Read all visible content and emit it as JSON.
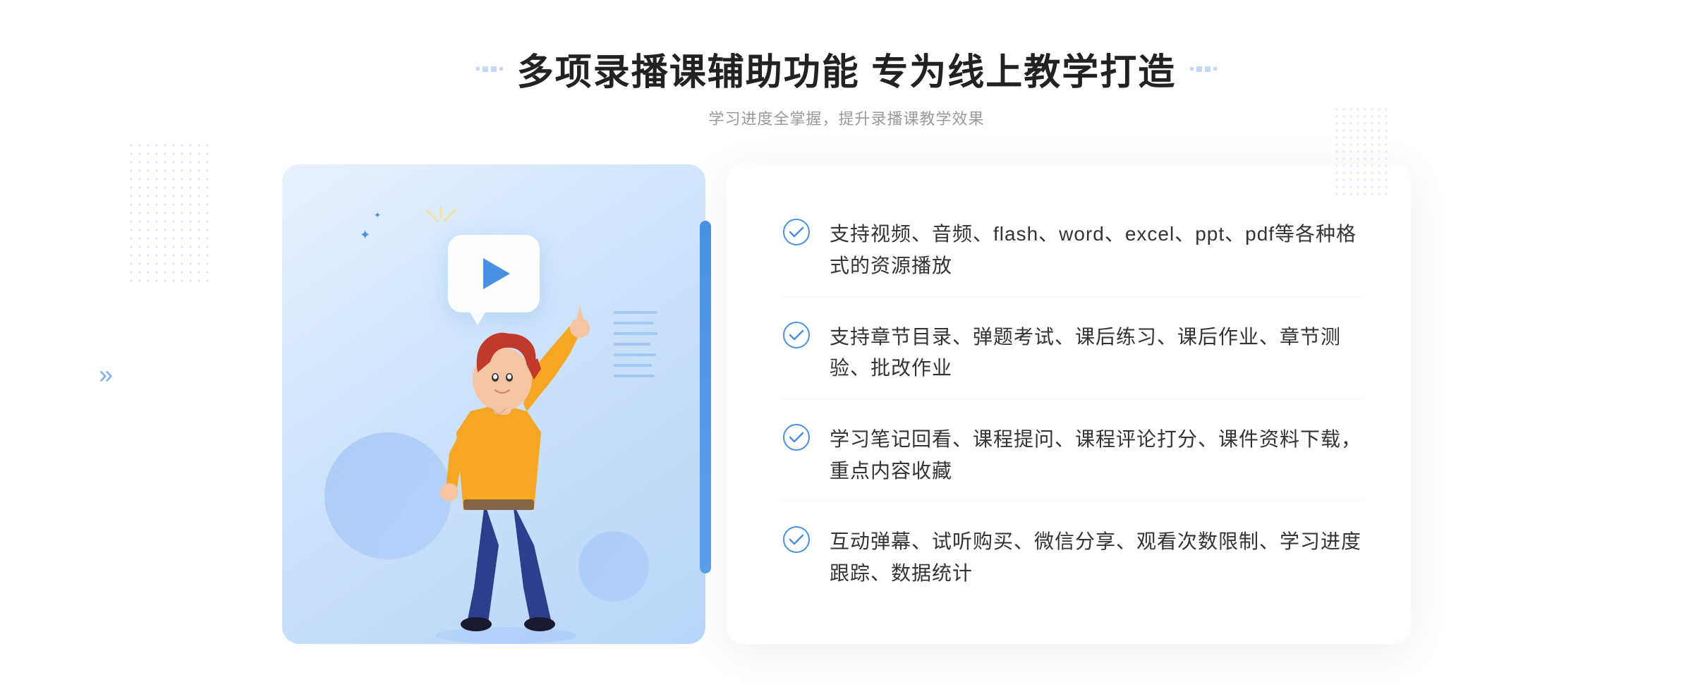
{
  "header": {
    "title": "多项录播课辅助功能 专为线上教学打造",
    "subtitle": "学习进度全掌握，提升录播课教学效果"
  },
  "features": [
    {
      "id": 1,
      "text": "支持视频、音频、flash、word、excel、ppt、pdf等各种格式的资源播放"
    },
    {
      "id": 2,
      "text": "支持章节目录、弹题考试、课后练习、课后作业、章节测验、批改作业"
    },
    {
      "id": 3,
      "text": "学习笔记回看、课程提问、课程评论打分、课件资料下载，重点内容收藏"
    },
    {
      "id": 4,
      "text": "互动弹幕、试听购买、微信分享、观看次数限制、学习进度跟踪、数据统计"
    }
  ],
  "colors": {
    "accent": "#4a90e2",
    "title": "#222222",
    "subtitle": "#999999",
    "featureText": "#333333"
  },
  "icons": {
    "play": "▶",
    "check": "✓",
    "chevronLeft": "»"
  }
}
